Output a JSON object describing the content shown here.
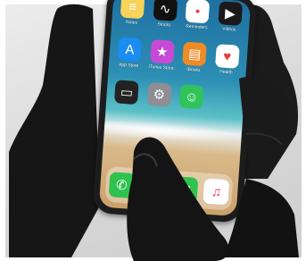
{
  "apps": [
    {
      "label": "Notes",
      "icon": "notes-icon",
      "color": "#f7d35c",
      "glyph": "≡"
    },
    {
      "label": "Stocks",
      "icon": "stocks-icon",
      "color": "#111111",
      "glyph": "∿"
    },
    {
      "label": "Reminders",
      "icon": "reminders-icon",
      "color": "#ffffff",
      "glyph": "•"
    },
    {
      "label": "Videos",
      "icon": "videos-icon",
      "color": "#1a1a1a",
      "glyph": "▶"
    },
    {
      "label": "App Store",
      "icon": "app-store-icon",
      "color": "#1b8cf0",
      "glyph": "A"
    },
    {
      "label": "iTunes Store",
      "icon": "itunes-store-icon",
      "color": "#c74ad6",
      "glyph": "★"
    },
    {
      "label": "iBooks",
      "icon": "ibooks-icon",
      "color": "#f08a24",
      "glyph": "▤"
    },
    {
      "label": "Health",
      "icon": "health-icon",
      "color": "#ffffff",
      "glyph": "♥"
    },
    {
      "label": "",
      "icon": "wallet-icon",
      "color": "#222222",
      "glyph": "▭"
    },
    {
      "label": "",
      "icon": "settings-icon",
      "color": "#8e8e93",
      "glyph": "⚙"
    },
    {
      "label": "",
      "icon": "face-id-icon",
      "color": "#30c35a",
      "glyph": "☺"
    }
  ],
  "dock": [
    {
      "icon": "phone-icon",
      "color": "#2fc24f",
      "glyph": "✆"
    },
    {
      "icon": "safari-icon",
      "color": "#2e8df5",
      "glyph": "◎"
    },
    {
      "icon": "messages-icon",
      "color": "#2fc24f",
      "glyph": "✉"
    },
    {
      "icon": "music-icon",
      "color": "#ffffff",
      "glyph": "♫"
    }
  ],
  "colors": {
    "glove": "#1a1a1a",
    "background": "#dcdcdc"
  }
}
